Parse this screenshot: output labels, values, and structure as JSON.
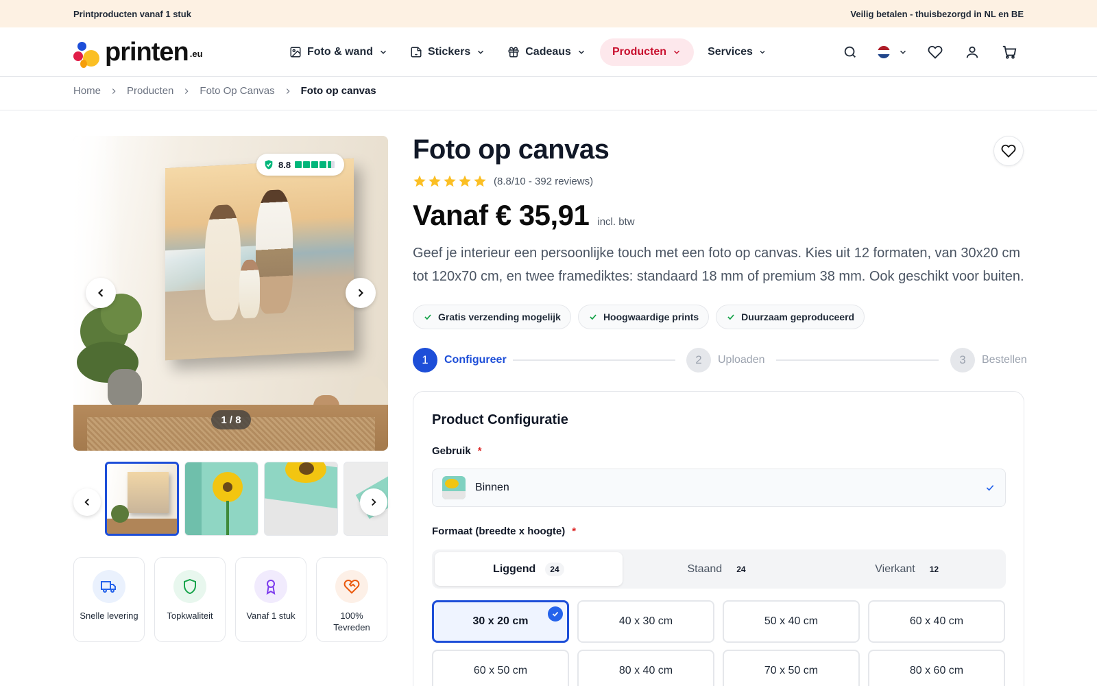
{
  "topbar": {
    "left": "Printproducten vanaf 1 stuk",
    "right": "Veilig betalen - thuisbezorgd in NL en BE"
  },
  "logo": {
    "word": "printen",
    "tld": ".eu"
  },
  "nav": [
    {
      "label": "Foto & wand",
      "icon": "image-icon"
    },
    {
      "label": "Stickers",
      "icon": "sticker-icon"
    },
    {
      "label": "Cadeaus",
      "icon": "gift-icon"
    },
    {
      "label": "Producten",
      "icon": "",
      "active": true
    },
    {
      "label": "Services",
      "icon": ""
    }
  ],
  "breadcrumb": [
    "Home",
    "Producten",
    "Foto Op Canvas",
    "Foto op canvas"
  ],
  "gallery": {
    "rating_score": "8.8",
    "counter": "1 / 8"
  },
  "features": [
    {
      "label": "Snelle levering",
      "icon": "truck-icon",
      "color": "#2563eb",
      "bg": "#eaf1fd"
    },
    {
      "label": "Topkwaliteit",
      "icon": "shield-icon",
      "color": "#16a34a",
      "bg": "#e8f7ee"
    },
    {
      "label": "Vanaf 1 stuk",
      "icon": "award-icon",
      "color": "#7c3aed",
      "bg": "#f1ebfd"
    },
    {
      "label": "100% Tevreden",
      "icon": "heart-handshake-icon",
      "color": "#ea580c",
      "bg": "#fdf0e7"
    }
  ],
  "product": {
    "title": "Foto op canvas",
    "reviews": "(8.8/10 - 392 reviews)",
    "rating_stars": 5,
    "price": "Vanaf € 35,91",
    "price_note": "incl. btw",
    "description": "Geef je interieur een persoonlijke touch met een foto op canvas. Kies uit 12 formaten, van 30x20 cm tot 120x70 cm, en twee framediktes: standaard 18 mm of premium 38 mm. Ook geschikt voor buiten."
  },
  "badges": [
    "Gratis verzending mogelijk",
    "Hoogwaardige prints",
    "Duurzaam geproduceerd"
  ],
  "steps": [
    {
      "num": "1",
      "label": "Configureer",
      "active": true
    },
    {
      "num": "2",
      "label": "Uploaden",
      "active": false
    },
    {
      "num": "3",
      "label": "Bestellen",
      "active": false
    }
  ],
  "config": {
    "title": "Product Configuratie",
    "usage_label": "Gebruik",
    "usage_value": "Binnen",
    "format_label": "Formaat (breedte x hoogte)",
    "required_mark": "*",
    "orientation": [
      {
        "label": "Liggend",
        "count": "24",
        "active": true
      },
      {
        "label": "Staand",
        "count": "24",
        "active": false
      },
      {
        "label": "Vierkant",
        "count": "12",
        "active": false
      }
    ],
    "sizes": [
      {
        "label": "30 x 20 cm",
        "selected": true
      },
      {
        "label": "40 x 30 cm",
        "selected": false
      },
      {
        "label": "50 x 40 cm",
        "selected": false
      },
      {
        "label": "60 x 40 cm",
        "selected": false
      },
      {
        "label": "60 x 50 cm",
        "selected": false
      },
      {
        "label": "80 x 40 cm",
        "selected": false
      },
      {
        "label": "70 x 50 cm",
        "selected": false
      },
      {
        "label": "80 x 60 cm",
        "selected": false
      }
    ]
  },
  "colors": {
    "accent": "#1d4ed8",
    "brand_red": "#c8102e",
    "announcement_bg": "#fdf1e3"
  }
}
